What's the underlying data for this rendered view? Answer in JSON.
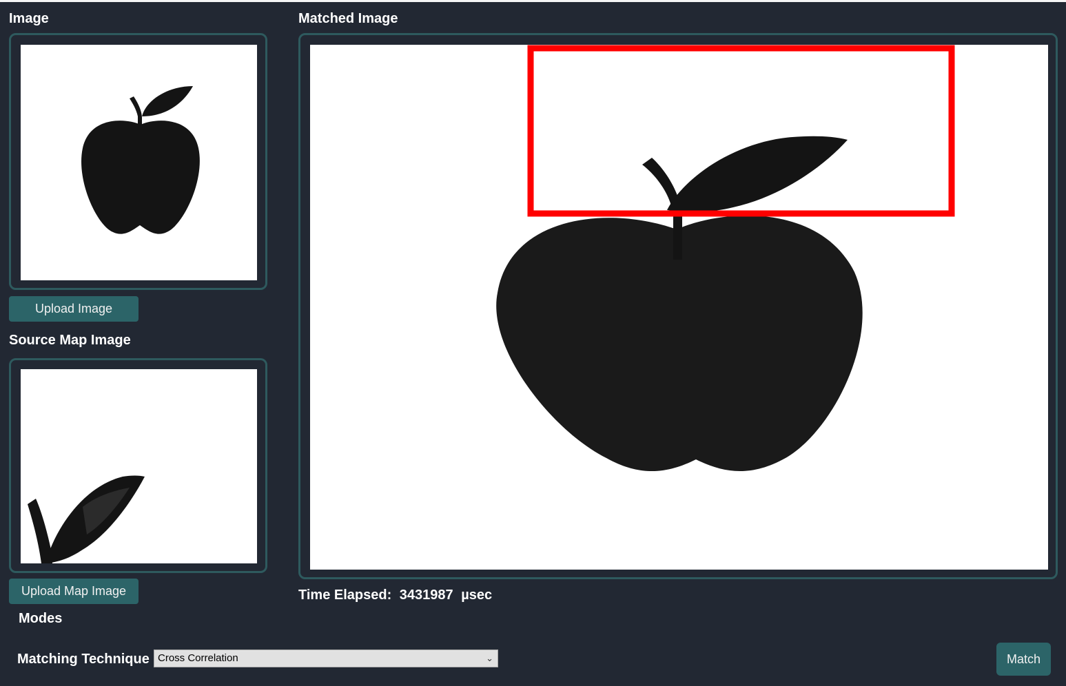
{
  "image_section": {
    "label": "Image",
    "upload_button": "Upload Image"
  },
  "map_section": {
    "label": "Source Map Image",
    "upload_button": "Upload Map Image"
  },
  "matched_section": {
    "label": "Matched Image",
    "match_box_color": "#ff0000"
  },
  "time": {
    "label": "Time Elapsed:",
    "value": "3431987",
    "unit": "µsec"
  },
  "modes": {
    "label": "Modes"
  },
  "technique": {
    "label": "Matching Technique",
    "selected": "Cross Correlation"
  },
  "match_button": "Match",
  "colors": {
    "panel_border": "#2e5a5e",
    "button": "#2c6468",
    "background": "#222833"
  }
}
